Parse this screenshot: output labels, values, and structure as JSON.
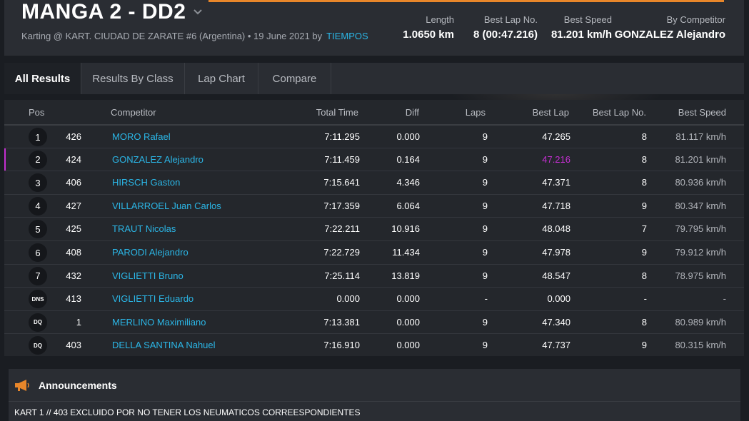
{
  "header": {
    "title": "MANGA 2 - DD2",
    "subtitle": "Karting @ KART. CIUDAD DE ZARATE #6 (Argentina) • 19 June 2021 by",
    "by_link": "TIEMPOS",
    "stats": [
      {
        "label": "Length",
        "value": "1.0650 km"
      },
      {
        "label": "Best Lap No.",
        "value": "8 (00:47.216)"
      },
      {
        "label": "Best Speed",
        "value": "81.201 km/h"
      },
      {
        "label": "By Competitor",
        "value": "GONZALEZ Alejandro"
      }
    ]
  },
  "tabs": [
    "All Results",
    "Results By Class",
    "Lap Chart",
    "Compare"
  ],
  "columns": [
    "Pos",
    "Competitor",
    "Total Time",
    "Diff",
    "Laps",
    "Best Lap",
    "Best Lap No.",
    "Best Speed"
  ],
  "rows": [
    {
      "pos": "1",
      "num": "426",
      "name": "MORO Rafael",
      "total": "7:11.295",
      "diff": "0.000",
      "laps": "9",
      "best": "47.265",
      "bestno": "8",
      "speed": "81.117 km/h"
    },
    {
      "pos": "2",
      "num": "424",
      "name": "GONZALEZ Alejandro",
      "total": "7:11.459",
      "diff": "0.164",
      "laps": "9",
      "best": "47.216",
      "bestno": "8",
      "speed": "81.201 km/h"
    },
    {
      "pos": "3",
      "num": "406",
      "name": "HIRSCH Gaston",
      "total": "7:15.641",
      "diff": "4.346",
      "laps": "9",
      "best": "47.371",
      "bestno": "8",
      "speed": "80.936 km/h"
    },
    {
      "pos": "4",
      "num": "427",
      "name": "VILLARROEL Juan Carlos",
      "total": "7:17.359",
      "diff": "6.064",
      "laps": "9",
      "best": "47.718",
      "bestno": "9",
      "speed": "80.347 km/h"
    },
    {
      "pos": "5",
      "num": "425",
      "name": "TRAUT Nicolas",
      "total": "7:22.211",
      "diff": "10.916",
      "laps": "9",
      "best": "48.048",
      "bestno": "7",
      "speed": "79.795 km/h"
    },
    {
      "pos": "6",
      "num": "408",
      "name": "PARODI Alejandro",
      "total": "7:22.729",
      "diff": "11.434",
      "laps": "9",
      "best": "47.978",
      "bestno": "9",
      "speed": "79.912 km/h"
    },
    {
      "pos": "7",
      "num": "432",
      "name": "VIGLIETTI Bruno",
      "total": "7:25.114",
      "diff": "13.819",
      "laps": "9",
      "best": "48.547",
      "bestno": "8",
      "speed": "78.975 km/h"
    },
    {
      "pos": "DNS",
      "num": "413",
      "name": "VIGLIETTI Eduardo",
      "total": "0.000",
      "diff": "0.000",
      "laps": "-",
      "best": "0.000",
      "bestno": "-",
      "speed": "-"
    },
    {
      "pos": "DQ",
      "num": "1",
      "name": "MERLINO Maximiliano",
      "total": "7:13.381",
      "diff": "0.000",
      "laps": "9",
      "best": "47.340",
      "bestno": "8",
      "speed": "80.989 km/h"
    },
    {
      "pos": "DQ",
      "num": "403",
      "name": "DELLA SANTINA Nahuel",
      "total": "7:16.910",
      "diff": "0.000",
      "laps": "9",
      "best": "47.737",
      "bestno": "9",
      "speed": "80.315 km/h"
    }
  ],
  "announcements": {
    "title": "Announcements",
    "text": "KART 1 // 403 EXCLUIDO POR NO TENER LOS NEUMATICOS CORREESPONDIENTES"
  },
  "colors": {
    "accent": "#e8862a",
    "link": "#2bb6e6",
    "best_highlight": "#c52fd2"
  }
}
